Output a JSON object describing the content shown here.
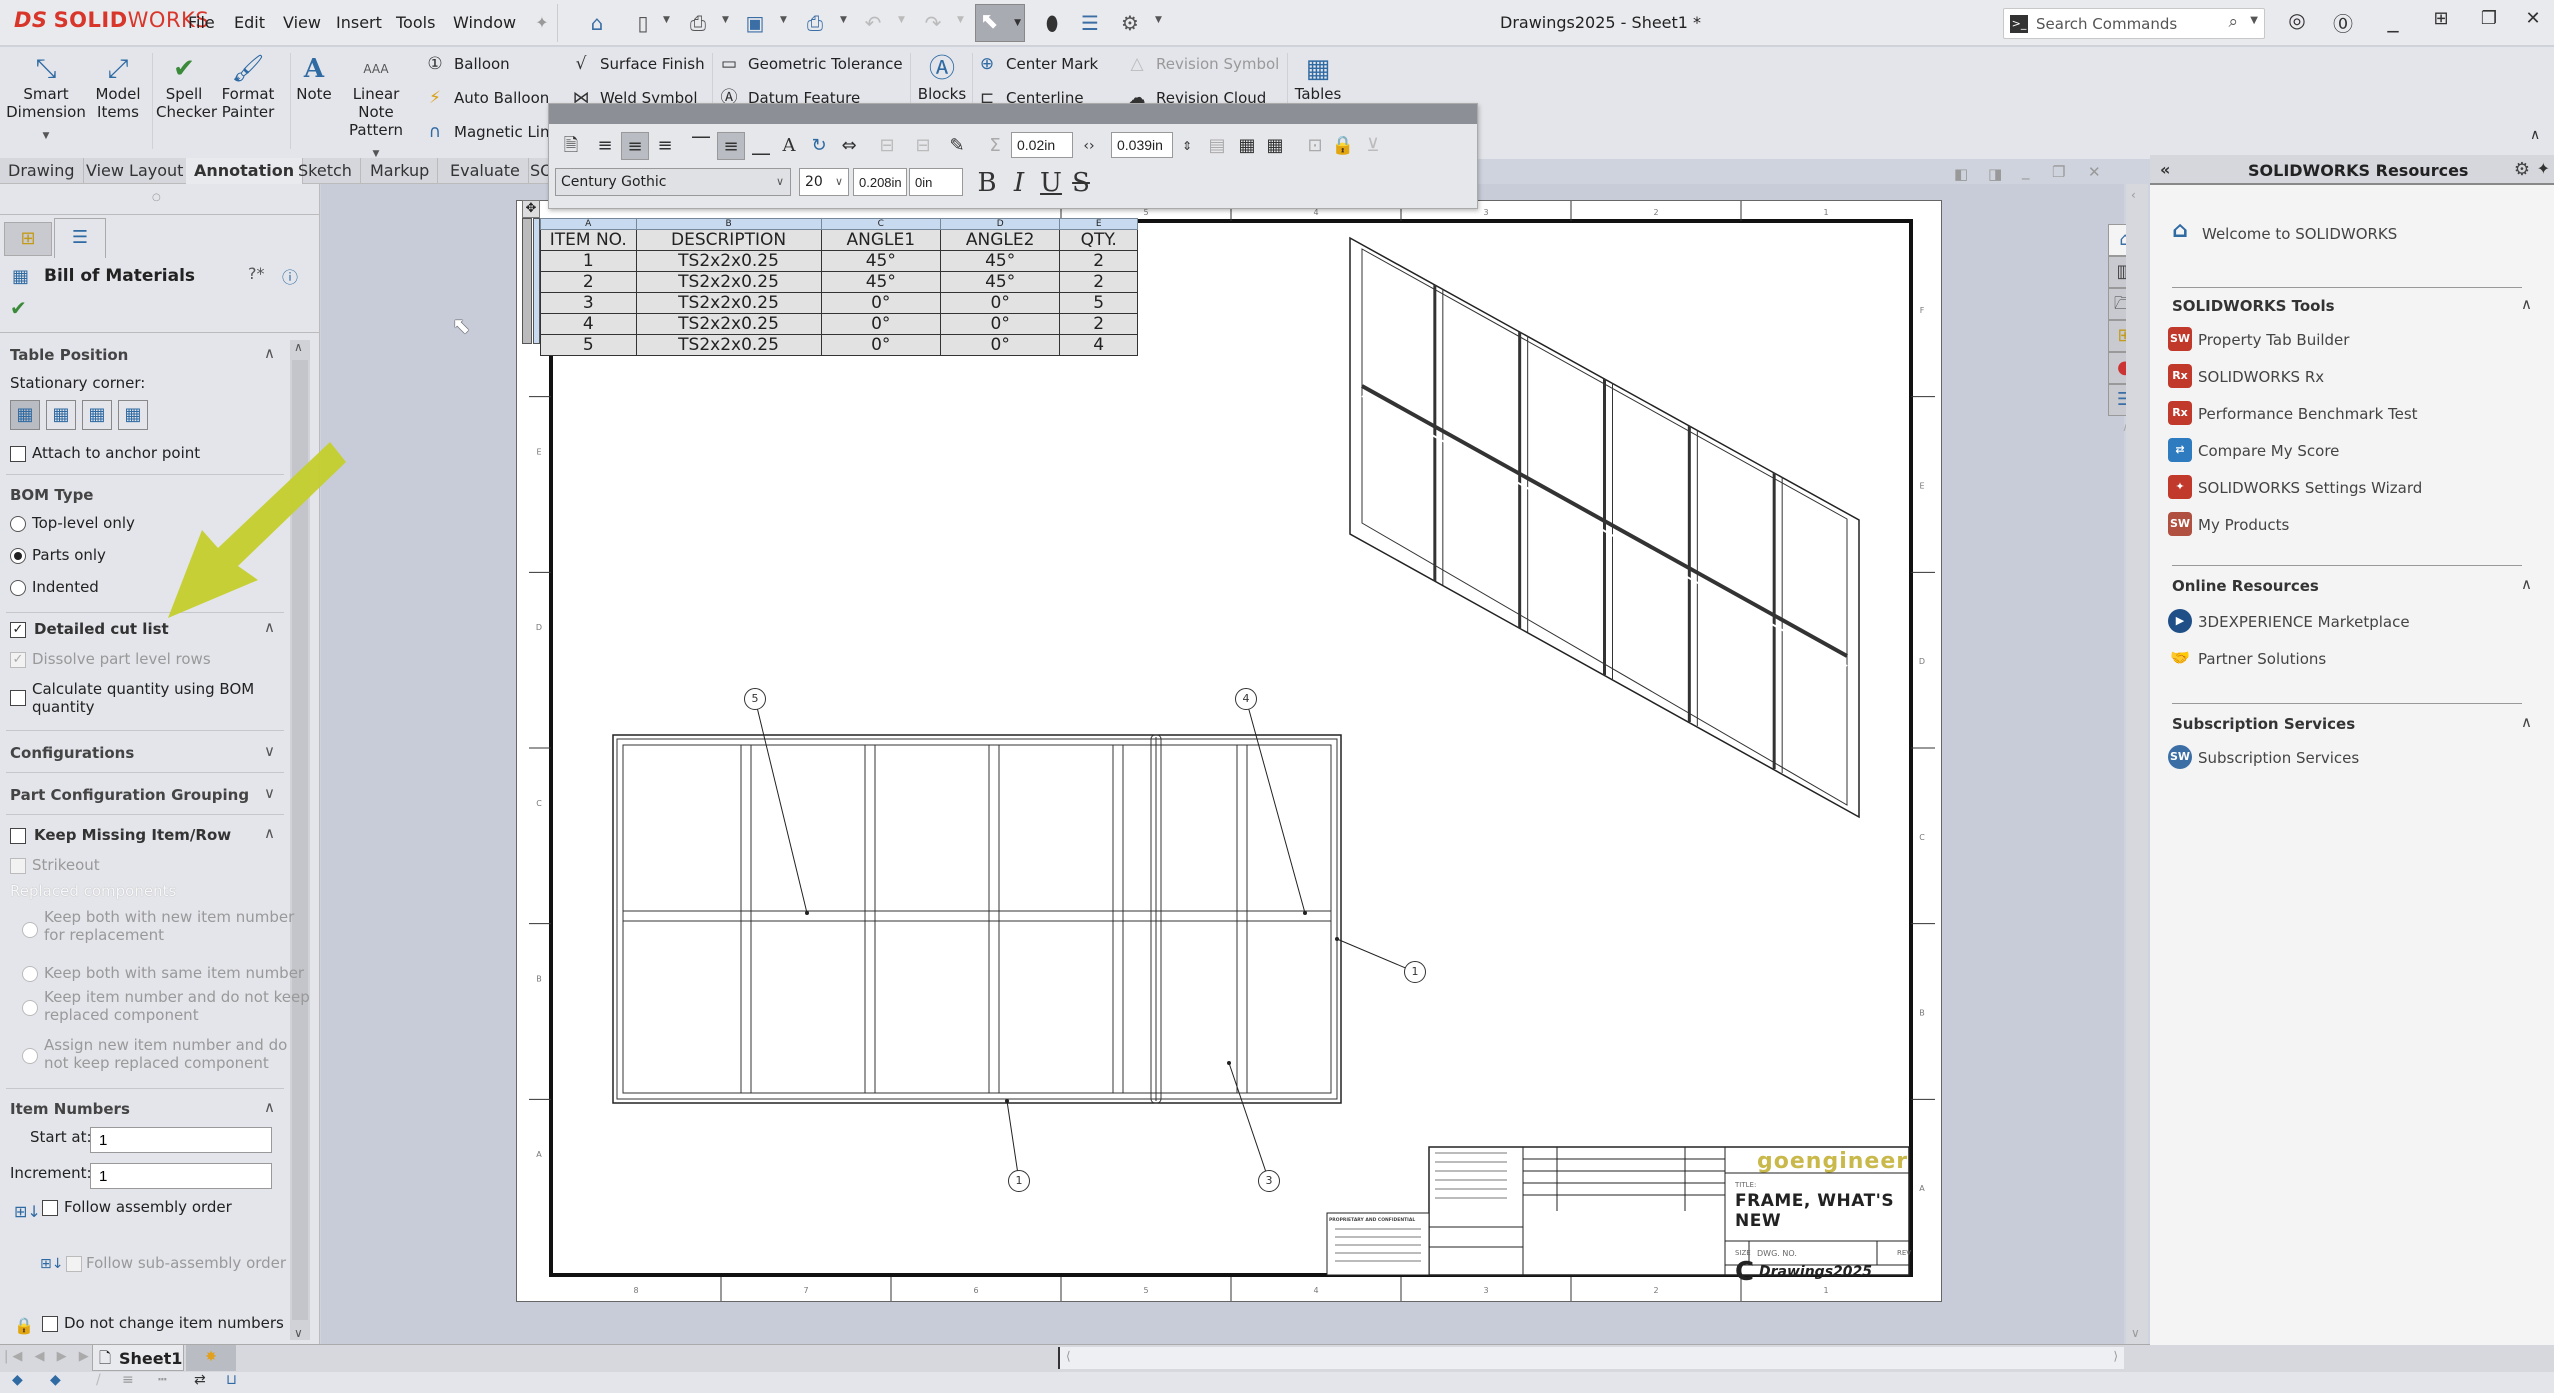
{
  "app": {
    "logo_ds": "DS",
    "logo_solid": "SOLID",
    "logo_works": "WORKS",
    "document_title": "Drawings2025 - Sheet1 *",
    "menu": [
      "File",
      "Edit",
      "View",
      "Insert",
      "Tools",
      "Window"
    ],
    "search_placeholder": "Search Commands",
    "icons": {
      "home": "⌂",
      "new": "🗋",
      "open": "📂",
      "save": "💾",
      "print": "🖶",
      "undo": "↶",
      "redo": "↷",
      "select": "⬉",
      "traffic": "●",
      "file-props": "☰",
      "options": "⚙",
      "user": "◯",
      "help": "?",
      "minimize": "_",
      "tile": "⊞",
      "restore": "❐",
      "close": "✕",
      "pin": "📌"
    }
  },
  "ribbon": {
    "smart_dimension": "Smart Dimension",
    "model_items": "Model Items",
    "spell_checker": "Spell Checker",
    "format_painter": "Format Painter",
    "note": "Note",
    "linear_note_pattern": "Linear Note Pattern",
    "balloon": "Balloon",
    "auto_balloon": "Auto Balloon",
    "magnetic_line": "Magnetic Lin",
    "surface_finish": "Surface Finish",
    "weld_symbol": "Weld Symbol",
    "geometric_tolerance": "Geometric Tolerance",
    "datum_feature": "Datum Feature",
    "blocks": "Blocks",
    "center_mark": "Center Mark",
    "centerline": "Centerline",
    "revision_symbol": "Revision Symbol",
    "revision_cloud": "Revision Cloud",
    "tables": "Tables"
  },
  "tabs": [
    {
      "label": "Drawing",
      "active": false
    },
    {
      "label": "View Layout",
      "active": false
    },
    {
      "label": "Annotation",
      "active": true
    },
    {
      "label": "Sketch",
      "active": false
    },
    {
      "label": "Markup",
      "active": false
    },
    {
      "label": "Evaluate",
      "active": false
    },
    {
      "label": "SO",
      "active": false
    }
  ],
  "format_toolbar": {
    "font": "Century Gothic",
    "font_size": "20",
    "height": "0.208in",
    "spacing": "0in",
    "horiz_padding": "0.02in",
    "vert_padding": "0.039in",
    "bold": "B",
    "italic": "I",
    "underline": "U",
    "strike": "S"
  },
  "property_manager": {
    "title": "Bill of Materials",
    "table_position": "Table Position",
    "stationary_corner": "Stationary corner:",
    "attach_anchor": "Attach to anchor point",
    "attach_anchor_checked": false,
    "bom_type": "BOM Type",
    "bom_type_options": [
      {
        "label": "Top-level only",
        "selected": false
      },
      {
        "label": "Parts only",
        "selected": true
      },
      {
        "label": "Indented",
        "selected": false
      }
    ],
    "detailed_cut_list": "Detailed cut list",
    "detailed_cut_list_checked": true,
    "dissolve_part_level": "Dissolve part level rows",
    "calc_qty_line1": "Calculate quantity using BOM",
    "calc_qty_line2": "quantity",
    "configurations": "Configurations",
    "part_config_grouping": "Part Configuration Grouping",
    "keep_missing": "Keep Missing Item/Row",
    "strikeout": "Strikeout",
    "replaced_components": "Replaced components",
    "replaced_options": [
      [
        "Keep both with new item number",
        "for replacement"
      ],
      [
        "Keep both with same item number",
        ""
      ],
      [
        "Keep item number and do not keep",
        "replaced component"
      ],
      [
        "Assign new item number and do",
        "not keep replaced component"
      ]
    ],
    "item_numbers": "Item Numbers",
    "start_at_label": "Start at:",
    "start_at": "1",
    "increment_label": "Increment:",
    "increment": "1",
    "follow_assembly": "Follow assembly order",
    "follow_subassembly": "Follow sub-assembly order",
    "do_not_change": "Do not change item numbers"
  },
  "sheet_tabs": {
    "active": "Sheet1"
  },
  "bom": {
    "col_letters": [
      "A",
      "B",
      "C",
      "D",
      "E"
    ],
    "headers": [
      "ITEM NO.",
      "DESCRIPTION",
      "ANGLE1",
      "ANGLE2",
      "QTY."
    ],
    "rows": [
      [
        "1",
        "TS2x2x0.25",
        "45°",
        "45°",
        "2"
      ],
      [
        "2",
        "TS2x2x0.25",
        "45°",
        "45°",
        "2"
      ],
      [
        "3",
        "TS2x2x0.25",
        "0°",
        "0°",
        "5"
      ],
      [
        "4",
        "TS2x2x0.25",
        "0°",
        "0°",
        "2"
      ],
      [
        "5",
        "TS2x2x0.25",
        "0°",
        "0°",
        "4"
      ]
    ]
  },
  "drawing": {
    "zone_numbers_bottom": [
      "8",
      "7",
      "6",
      "5",
      "4",
      "3",
      "2",
      "1"
    ],
    "zone_numbers_top": [
      "5",
      "4",
      "3",
      "2",
      "1"
    ],
    "zone_letters_left": [
      "E",
      "D",
      "C",
      "B",
      "A"
    ],
    "zone_letters_right": [
      "F",
      "E",
      "D",
      "C",
      "B",
      "A"
    ],
    "balloons": [
      "5",
      "4",
      "1",
      "1",
      "3"
    ],
    "title_block": {
      "company": "goengineer",
      "title_label": "TITLE:",
      "title": "FRAME, WHAT'S NEW",
      "size_label": "SIZE",
      "size": "C",
      "dwg_no_label": "DWG. NO.",
      "dwg_no": "Drawings2025",
      "rev_label": "REV",
      "proprietary": "PROPRIETARY AND CONFIDENTIAL"
    }
  },
  "resources": {
    "title": "SOLIDWORKS Resources",
    "welcome": "Welcome to SOLIDWORKS",
    "sections": [
      {
        "title": "SOLIDWORKS Tools",
        "items": [
          "Property Tab Builder",
          "SOLIDWORKS Rx",
          "Performance Benchmark Test",
          "Compare My Score",
          "SOLIDWORKS Settings Wizard",
          "My Products"
        ]
      },
      {
        "title": "Online Resources",
        "items": [
          "3DEXPERIENCE Marketplace",
          "Partner Solutions"
        ]
      },
      {
        "title": "Subscription Services",
        "items": [
          "Subscription Services"
        ]
      }
    ]
  },
  "colors": {
    "brand": "#d8362a",
    "annotation_arrow": "#c4cf2c",
    "accent": "#2f6aa3"
  }
}
